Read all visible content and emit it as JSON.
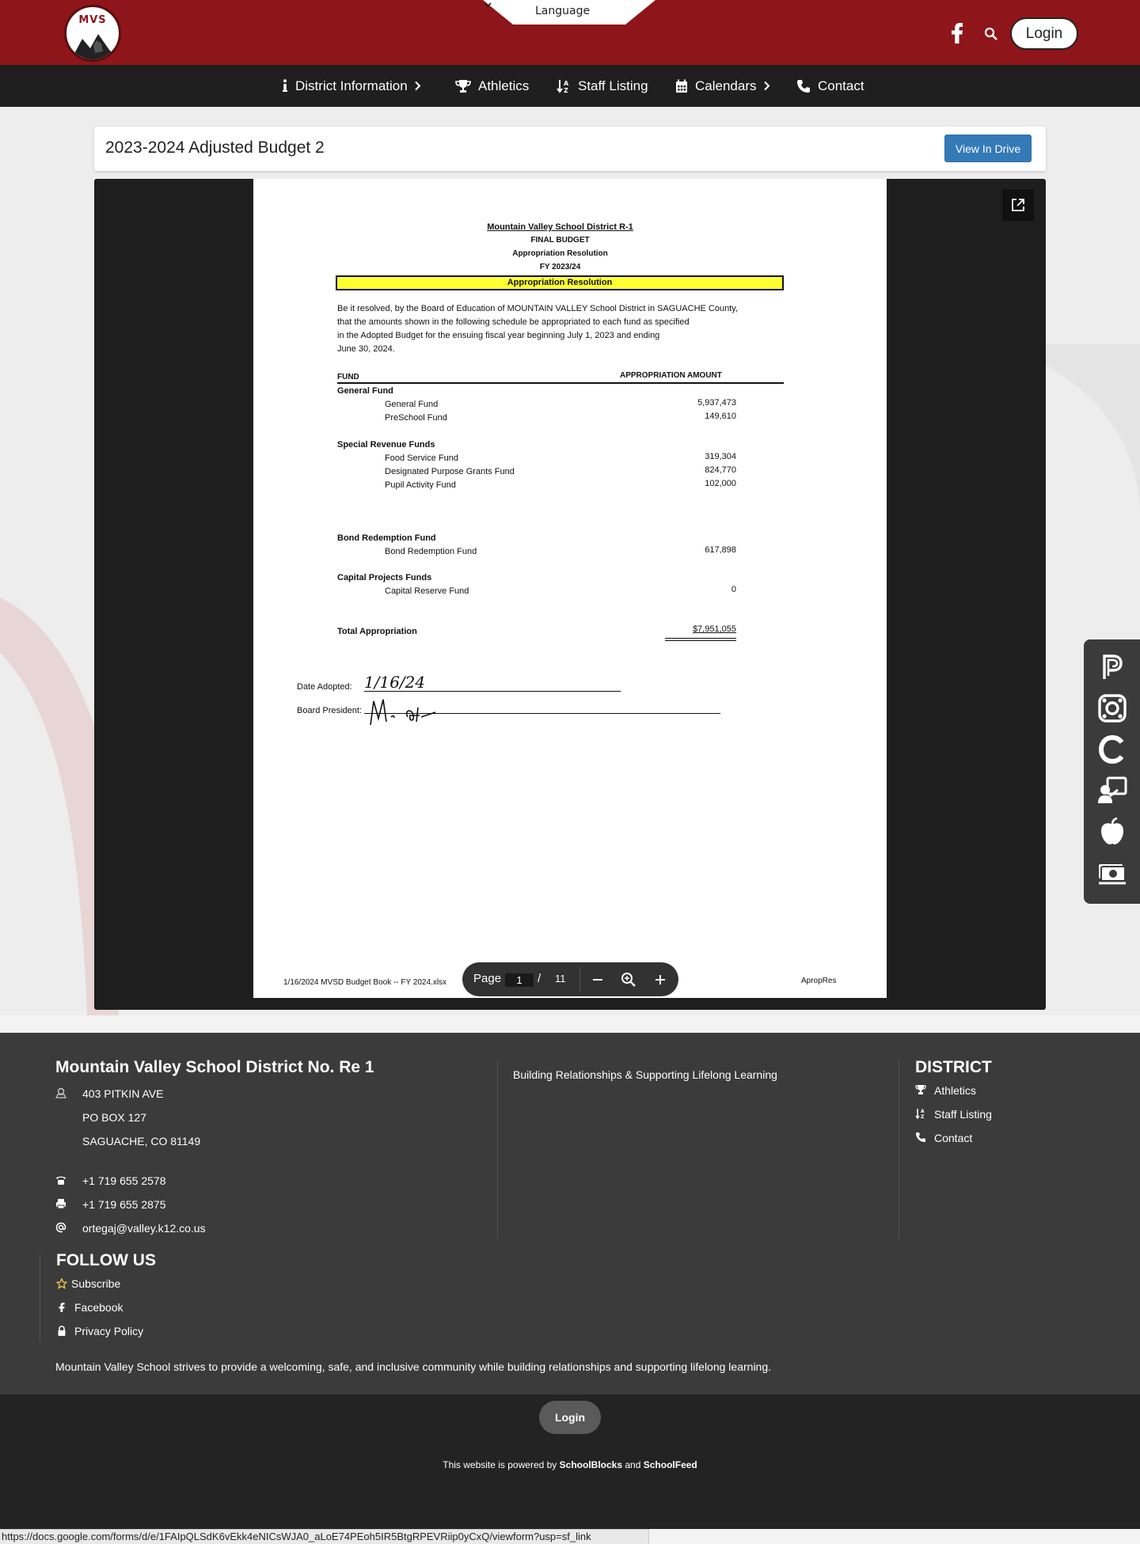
{
  "header": {
    "logo_text": "MVS",
    "language_label": "Language",
    "login_label": "Login"
  },
  "nav": {
    "items": [
      {
        "label": "District Information"
      },
      {
        "label": "Athletics"
      },
      {
        "label": "Staff Listing"
      },
      {
        "label": "Calendars"
      },
      {
        "label": "Contact"
      }
    ]
  },
  "main": {
    "title": "2023-2024 Adjusted Budget 2",
    "view_drive_label": "View In Drive"
  },
  "document": {
    "district": "Mountain Valley School District R-1",
    "budget_type": "FINAL BUDGET",
    "doc_title": "Appropriation Resolution",
    "fy": "FY 2023/24",
    "banner": "Appropriation Resolution",
    "para": [
      "Be it resolved, by the Board of Education of MOUNTAIN VALLEY School District in SAGUACHE County,",
      "that the amounts shown in the following schedule be appropriated to each fund as specified",
      "in the Adopted Budget for the ensuing fiscal year beginning July 1, 2023 and ending",
      "June 30, 2024."
    ],
    "col_fund": "FUND",
    "col_amount": "APPROPRIATION AMOUNT",
    "groups": [
      {
        "name": "General Fund",
        "rows": [
          {
            "label": "General Fund",
            "amount": "5,937,473"
          },
          {
            "label": "PreSchool Fund",
            "amount": "149,610"
          }
        ]
      },
      {
        "name": "Special Revenue Funds",
        "rows": [
          {
            "label": "Food Service Fund",
            "amount": "319,304"
          },
          {
            "label": "Designated Purpose Grants Fund",
            "amount": "824,770"
          },
          {
            "label": "Pupil Activity Fund",
            "amount": "102,000"
          }
        ]
      },
      {
        "name": "Bond Redemption Fund",
        "rows": [
          {
            "label": "Bond Redemption Fund",
            "amount": "617,898"
          }
        ]
      },
      {
        "name": "Capital Projects Funds",
        "rows": [
          {
            "label": "Capital Reserve Fund",
            "amount": "0"
          }
        ]
      }
    ],
    "total_label": "Total Appropriation",
    "total_amount": "$7,951,055",
    "date_adopted_label": "Date Adopted:",
    "date_adopted_value": "1/16/24",
    "president_label": "Board President:",
    "footer_left": "1/16/2024 MVSD Budget Book -- FY 2024.xlsx",
    "footer_right": "ApropRes"
  },
  "pdf_toolbar": {
    "page_label": "Page",
    "current_page": "1",
    "separator": "/",
    "total_pages": "11"
  },
  "footer": {
    "district_name": "Mountain Valley School District No. Re 1",
    "address": [
      "403 PITKIN AVE",
      "PO BOX 127",
      "SAGUACHE, CO 81149"
    ],
    "phone": "+1 719 655 2578",
    "fax": "+1 719 655 2875",
    "email": "ortegaj@valley.k12.co.us",
    "tagline": "Building Relationships & Supporting Lifelong Learning",
    "district_heading": "DISTRICT",
    "district_links": [
      "Athletics",
      "Staff Listing",
      "Contact"
    ],
    "follow_heading": "FOLLOW US",
    "follow_links": [
      "Subscribe",
      "Facebook",
      "Privacy Policy"
    ],
    "mission": "Mountain Valley School strives to provide a welcoming, safe, and inclusive community while building relationships and supporting lifelong learning.",
    "login_label": "Login",
    "powered_prefix": "This website is powered by",
    "powered_a": "SchoolBlocks",
    "powered_and": "and",
    "powered_b": "SchoolFeed"
  },
  "status_bar": {
    "url": "https://docs.google.com/forms/d/e/1FAIpQLSdK6vEkk4eNICsWJA0_aLoE74PEoh5IR5BtgRPEVRiip0yCxQ/viewform?usp=sf_link"
  },
  "colors": {
    "header_red": "#8e1519",
    "nav_dark": "#1f1f1f",
    "button_blue": "#337ab7",
    "footer_gray": "#3b3b3b",
    "highlight_yellow": "#ffff33"
  }
}
